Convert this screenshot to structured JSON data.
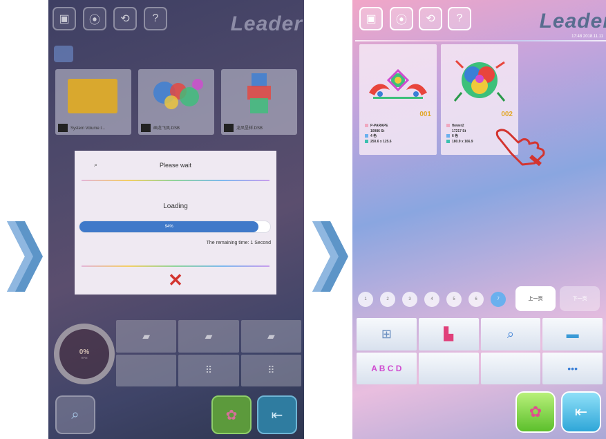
{
  "left_screen": {
    "brand": "Leader",
    "files": [
      {
        "name": "System Volume I..."
      },
      {
        "name": "画龙飞凤.DSB"
      },
      {
        "name": "龙凤呈祥.DSB"
      }
    ],
    "dialog": {
      "title": "Please wait",
      "status": "Loading",
      "progress_label": "94%",
      "progress": 0.94,
      "remaining": "The remaining time: 1 Second"
    },
    "speed": {
      "value": "0%",
      "unit": "RPM"
    }
  },
  "right_screen": {
    "brand": "Leader",
    "datetime": "17:48  2018.11.11",
    "designs": [
      {
        "number": "001",
        "name": "P-PARAPE",
        "stitches": "10986 St",
        "colors": "4 色",
        "size": "250.6 x 125.6"
      },
      {
        "number": "002",
        "name": "flower2",
        "stitches": "17217 St",
        "colors": "6 色",
        "size": "180.9 x 166.9"
      }
    ],
    "pages": [
      "1",
      "2",
      "3",
      "4",
      "5",
      "6",
      "7"
    ],
    "active_page": "7",
    "page_nav": {
      "prev_label": "上一页",
      "next_label": "下一页"
    }
  },
  "colors": {
    "accent": "#3f79c9",
    "close": "#d3342f",
    "number_badge": "#e2a82a"
  }
}
